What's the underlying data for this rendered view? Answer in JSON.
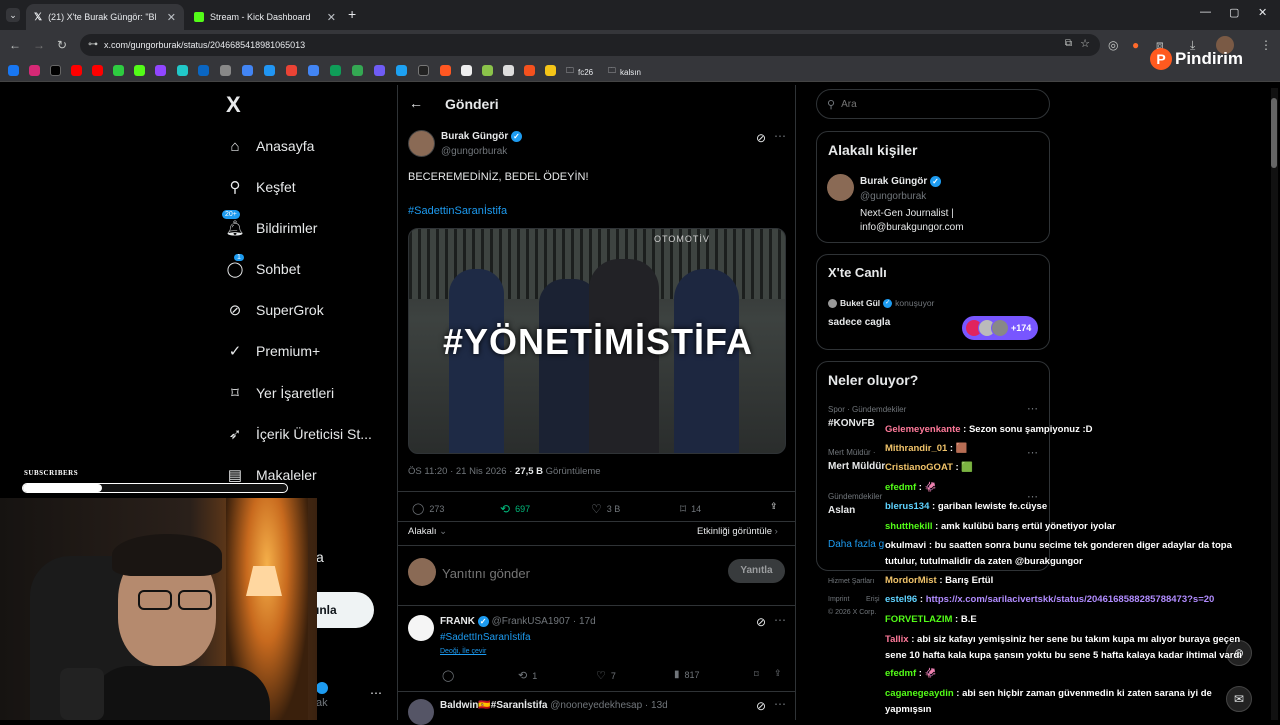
{
  "browser": {
    "tabs": [
      {
        "title": "(21) X'te Burak Güngör: \"BECER",
        "icon": "x-logo-icon",
        "active": true
      },
      {
        "title": "Stream - Kick Dashboard",
        "icon": "kick-logo-icon",
        "active": false
      }
    ],
    "new_tab": "+",
    "url": "x.com/gungorburak/status/2046685418981065013",
    "bookmark_folders": [
      "fc26",
      "kalsın"
    ],
    "watermark": "Pindirim"
  },
  "sidebar": {
    "logo": "X",
    "items": [
      {
        "label": "Anasayfa",
        "icon": "home-icon"
      },
      {
        "label": "Keşfet",
        "icon": "search-icon"
      },
      {
        "label": "Bildirimler",
        "icon": "bell-icon",
        "badge": "20+"
      },
      {
        "label": "Sohbet",
        "icon": "chat-icon",
        "badge": "1"
      },
      {
        "label": "SuperGrok",
        "icon": "grok-icon"
      },
      {
        "label": "Premium+",
        "icon": "premium-icon"
      },
      {
        "label": "Yer İşaretleri",
        "icon": "bookmark-icon"
      },
      {
        "label": "İçerik Üreticisi St...",
        "icon": "rocket-icon"
      },
      {
        "label": "Makaleler",
        "icon": "article-icon"
      }
    ],
    "partial_more": "a",
    "post_button": "ınla",
    "profile_handle": "ak"
  },
  "post": {
    "header": "Gönderi",
    "author_name": "Burak Güngör",
    "author_handle": "@gungorburak",
    "text": "BECEREMEDİNİZ, BEDEL ÖDEYİN!",
    "hashtag": "#SadettinSaranİstifa",
    "image_text": "#YÖNETİMİSTİFA",
    "image_sign": "OTOMOTİV",
    "time": "ÖS 11:20 · 21 Nis 2026 · ",
    "views_count": "27,5 B",
    "views_label": " Görüntüleme",
    "replies": "273",
    "reposts": "697",
    "likes": "3 B",
    "bookmarks": "14",
    "sort_label": "Alakalı",
    "activity_link": "Etkinliği görüntüle",
    "reply_placeholder": "Yanıtını gönder",
    "reply_button": "Yanıtla"
  },
  "replies": [
    {
      "name": "FRANK",
      "handle": "@FrankUSA1907 · 17d",
      "text": "#SadettInSaranİstifa",
      "translate": "Dеоği, İlе çevir",
      "replies": "",
      "reposts": "1",
      "likes": "7",
      "views": "817"
    },
    {
      "name": "Baldwin🇪🇸#Saranİstifa",
      "handle": "@nooneyedekhesap · 13d",
      "text": ""
    }
  ],
  "right": {
    "search_placeholder": "Ara",
    "relevant_title": "Alakalı kişiler",
    "relevant_name": "Burak Güngör",
    "relevant_handle": "@gungorburak",
    "relevant_bio": "Next-Gen Journalist | info@burakgungor.com",
    "live_title": "X'te Canlı",
    "live_user": "Buket Gül",
    "live_status": "konuşuyor",
    "live_text": "sadece cagla",
    "live_count": "+174",
    "trends_title": "Neler oluyor?",
    "trends": [
      {
        "category": "Spor · Gündemdekiler",
        "name": "#KONvFB"
      },
      {
        "category": "Mert Müldür · ",
        "name": "Mert Müldür"
      },
      {
        "category": "Gündemdekiler",
        "name": "Aslan"
      }
    ],
    "show_more": "Daha fazla g",
    "footer": [
      "Hizmet Şartları",
      "Imprint",
      "Erişi",
      "© 2026 X Corp."
    ]
  },
  "overlay": {
    "subscribers_label": "SUBSCRIBERS",
    "subscribers_progress": 0.3
  },
  "chat": [
    {
      "user": "Gelemeyenkante",
      "color": "#ff7a9a",
      "msg": "Sezon sonu şampiyonuz :D"
    },
    {
      "user": "Mithrandir_01",
      "color": "#f0c36a",
      "msg": "🟫"
    },
    {
      "user": "CristianoGOAT",
      "color": "#f0c36a",
      "msg": "🟩"
    },
    {
      "user": "efedmf",
      "color": "#53fc18",
      "msg": "🦑"
    },
    {
      "user": "blerus134",
      "color": "#5fd3ff",
      "msg": "gariban lewiste fe.cüyse"
    },
    {
      "user": "shutthekill",
      "color": "#53fc18",
      "msg": "amk kulübü barış ertül yönetiyor iyolar"
    },
    {
      "user": "okulmavi",
      "color": "#ffffff",
      "msg": "bu saatten sonra bunu secime tek gonderen diger adaylar da topa tutulur, tutulmalidir da zaten @burakgungor"
    },
    {
      "user": "MordorMist",
      "color": "#f0c36a",
      "msg": "Barış Ertül"
    },
    {
      "user": "estel96",
      "color": "#5fd3ff",
      "msg": "https://x.com/sarilacivertskk/status/2046168588285788473?s=20"
    },
    {
      "user": "FORVETLAZIM",
      "color": "#53fc18",
      "msg": "B.E"
    },
    {
      "user": "Tallix",
      "color": "#ff7a9a",
      "msg": "abi siz kafayı yemişsiniz her sene bu takım kupa mı alıyor buraya geçen sene 10 hafta kala kupa şansın yoktu bu sene 5 hafta kalaya kadar ihtimal vardı"
    },
    {
      "user": "efedmf",
      "color": "#53fc18",
      "msg": "🦑"
    },
    {
      "user": "caganegeaydin",
      "color": "#53fc18",
      "msg": "abi sen hiçbir zaman güvenmedin ki zaten sarana iyi de yapmışsın"
    }
  ]
}
